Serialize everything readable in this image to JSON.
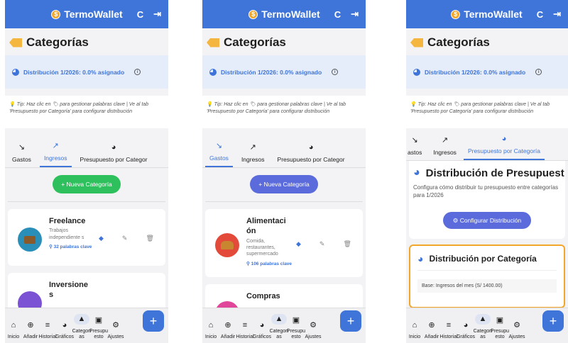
{
  "app": {
    "name": "TermoWallet",
    "refresh_icon": "refresh-icon",
    "logout_icon": "logout-icon"
  },
  "page": {
    "title": "Categorías"
  },
  "distribution": {
    "label": "Distribución 1/2026: 0.0% asignado"
  },
  "tip": {
    "text": "Tip: Haz clic en 🏷 para gestionar palabras clave | Ve al tab 'Presupuesto por Categoría' para configurar distribución"
  },
  "tabs": [
    "Gastos",
    "Ingresos",
    "Presupuesto por Categor"
  ],
  "tabs3": [
    "astos",
    "Ingresos",
    "Presupuesto por Categoría"
  ],
  "new_category": "+ Nueva Categoría",
  "screen1": {
    "cards": [
      {
        "name": "Freelance",
        "desc": "Trabajos independiente s",
        "keywords": "32 palabras clave"
      },
      {
        "name": "Inversione s",
        "desc": "",
        "keywords": ""
      }
    ]
  },
  "screen2": {
    "cards": [
      {
        "name": "Alimentaci ón",
        "desc": "Comida, restaurantes, supermercado",
        "keywords": "106 palabras clave"
      },
      {
        "name": "Compras",
        "desc": "",
        "keywords": ""
      }
    ]
  },
  "screen3": {
    "heading": "Distribución de Presupuest",
    "subtitle": "Configura cómo distribuir tu presupuesto entre categorías para 1/2026",
    "configure": "Configurar Distribución",
    "card_title": "Distribución por Categoría",
    "base": "Base: Ingresos del mes (S/ 1400.00)"
  },
  "nav": [
    {
      "label": "Inicio",
      "icon": "home-icon"
    },
    {
      "label": "Añadir",
      "icon": "add-circle-icon"
    },
    {
      "label": "Historial",
      "icon": "list-icon"
    },
    {
      "label": "Gráficos",
      "icon": "pie-icon"
    },
    {
      "label": "Categorí as",
      "icon": "categories-icon"
    },
    {
      "label": "Presupu esto",
      "icon": "budget-icon"
    },
    {
      "label": "Ajustes",
      "icon": "settings-icon"
    }
  ],
  "colors": {
    "primary": "#3f74d8",
    "green": "#2ec05c",
    "indigo": "#5b6bdc",
    "orange": "#f2a72a"
  }
}
